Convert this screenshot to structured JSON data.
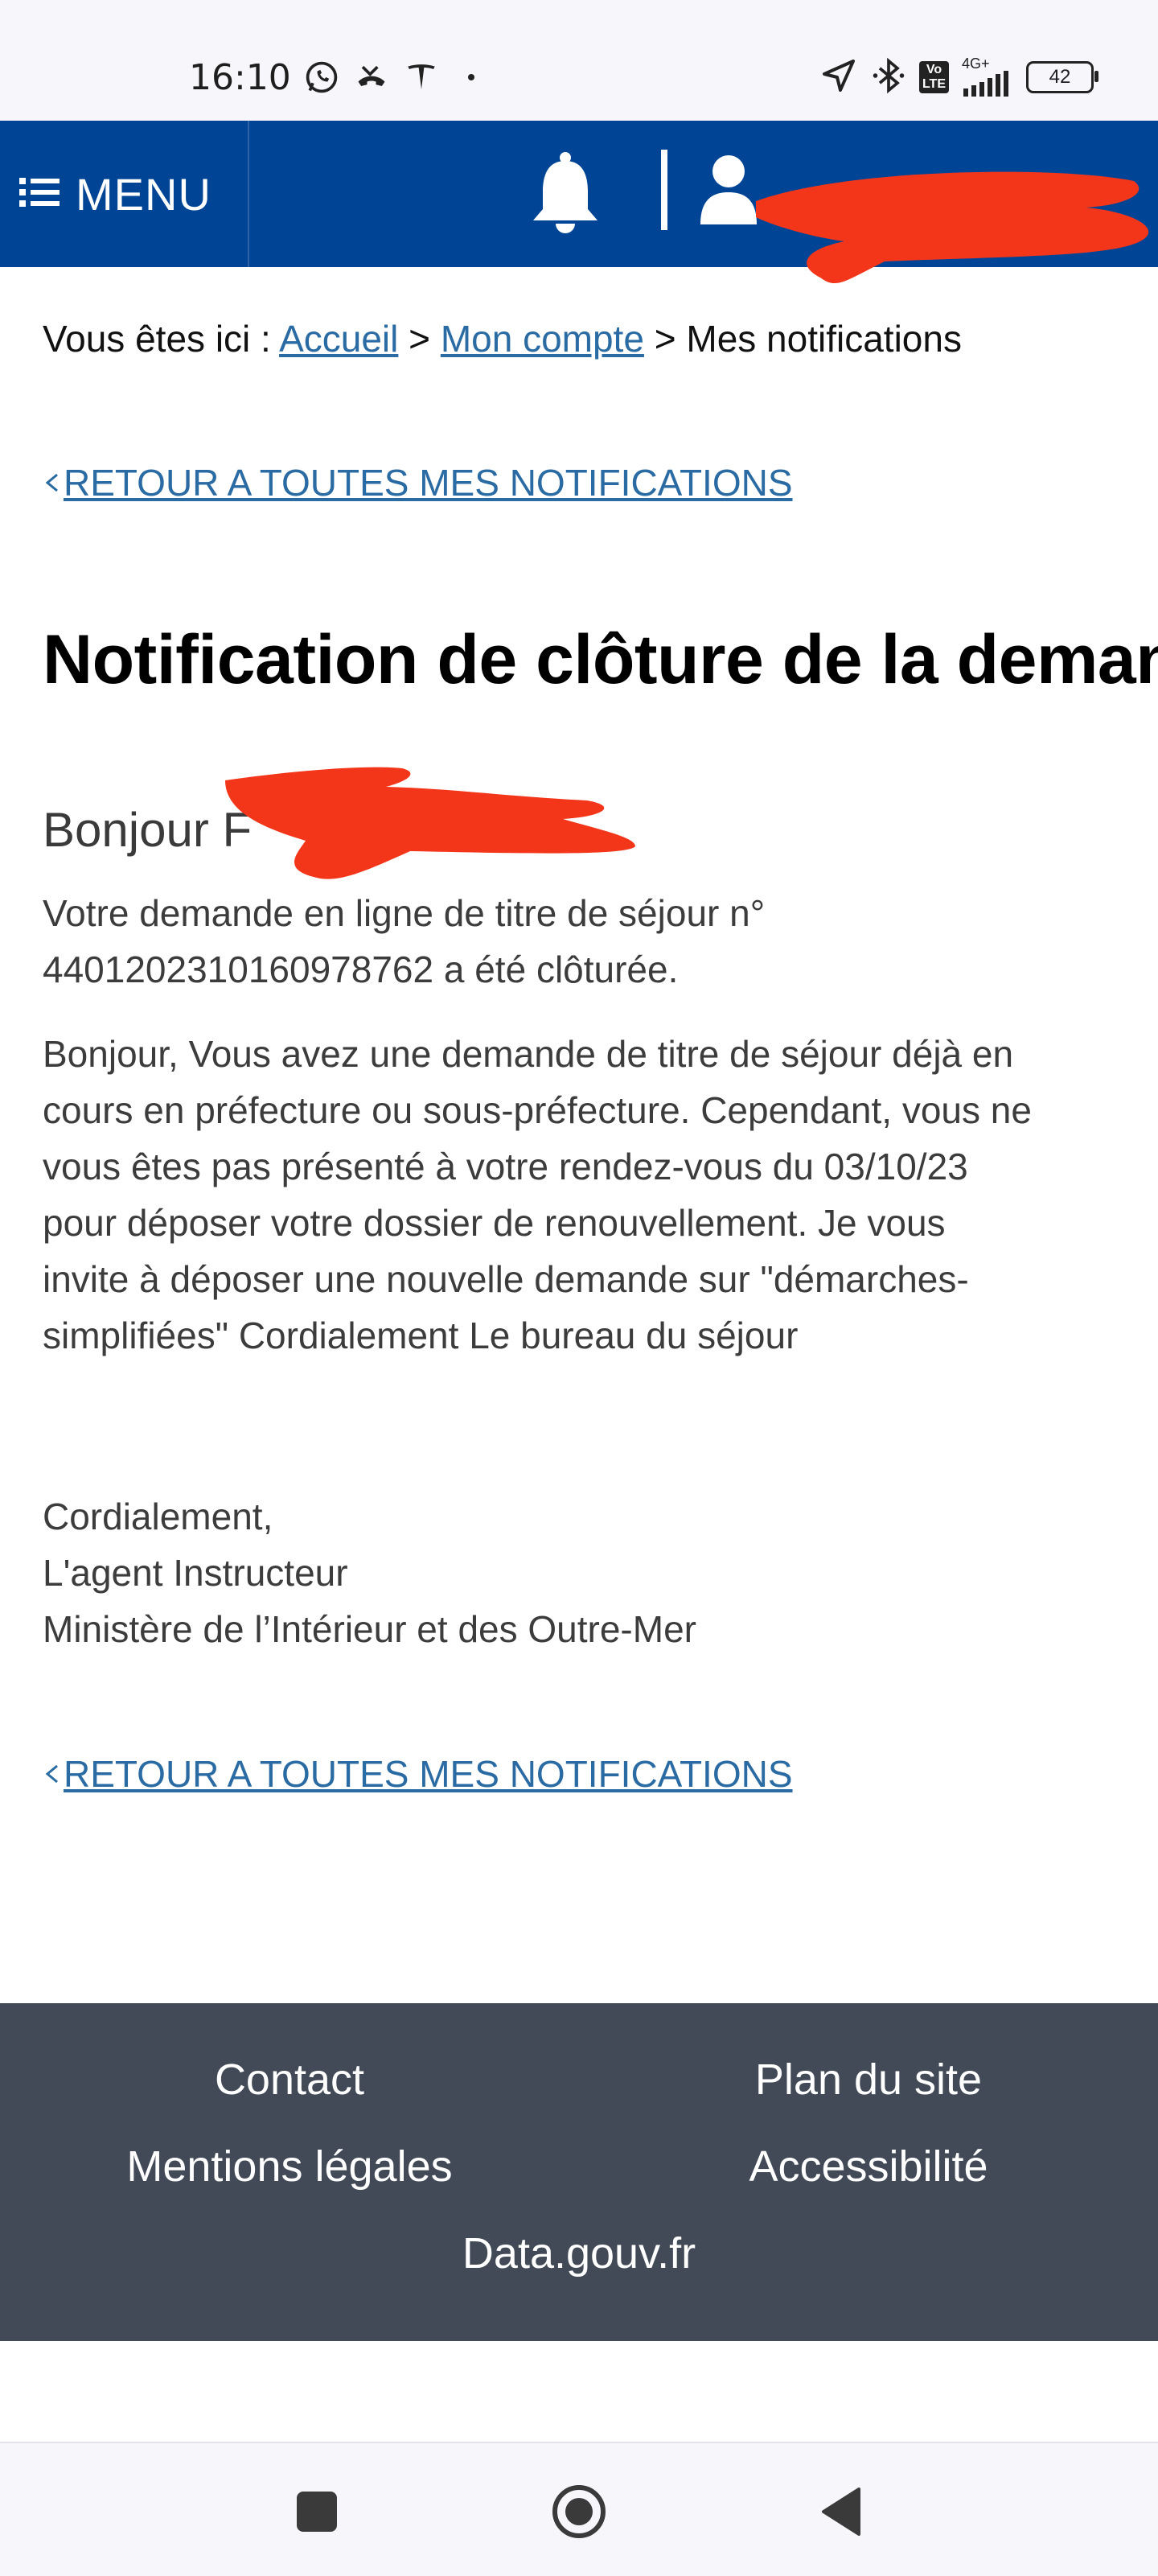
{
  "status_bar": {
    "time": "16:10",
    "icons_left": [
      "whatsapp-icon",
      "missed-call-icon",
      "tesla-icon",
      "dot-icon"
    ],
    "icons_right": [
      "location-arrow-icon",
      "bluetooth-icon",
      "volte-icon",
      "signal-icon",
      "battery-icon"
    ],
    "volte_label_top": "Vo",
    "volte_label_bottom": "LTE",
    "network_label": "4G+",
    "battery_level": "42"
  },
  "header": {
    "menu_label": "MENU",
    "accent_color": "#004595"
  },
  "breadcrumb": {
    "prefix": "Vous êtes ici :",
    "items": [
      {
        "label": "Accueil",
        "link": true
      },
      {
        "label": "Mon compte",
        "link": true
      },
      {
        "label": "Mes notifications",
        "link": false
      }
    ],
    "separator": ">"
  },
  "back_link_label": "RETOUR A TOUTES MES NOTIFICATIONS",
  "page_title": "Notification de clôture de la demande",
  "greeting": "Bonjour F",
  "message": {
    "line1": "Votre demande en ligne de titre de séjour n° 4401202310160978762 a été clôturée.",
    "body": "Bonjour, Vous avez une demande de titre de séjour déjà en cours en préfecture ou sous-préfecture. Cependant, vous ne vous êtes pas présenté à votre rendez-vous du 03/10/23 pour déposer votre dossier de renouvellement. Je vous invite à déposer une nouvelle demande sur \"démarches-simplifiées\" Cordialement Le bureau du séjour",
    "signature": [
      "Cordialement,",
      "L'agent Instructeur",
      "Ministère de l’Intérieur et des Outre-Mer"
    ]
  },
  "footer": {
    "links": [
      "Contact",
      "Plan du site",
      "Mentions légales",
      "Accessibilité",
      "Data.gouv.fr"
    ],
    "background": "#424957"
  },
  "nav_bar": {
    "buttons": [
      "recents-square-icon",
      "home-circle-icon",
      "back-triangle-icon"
    ]
  }
}
